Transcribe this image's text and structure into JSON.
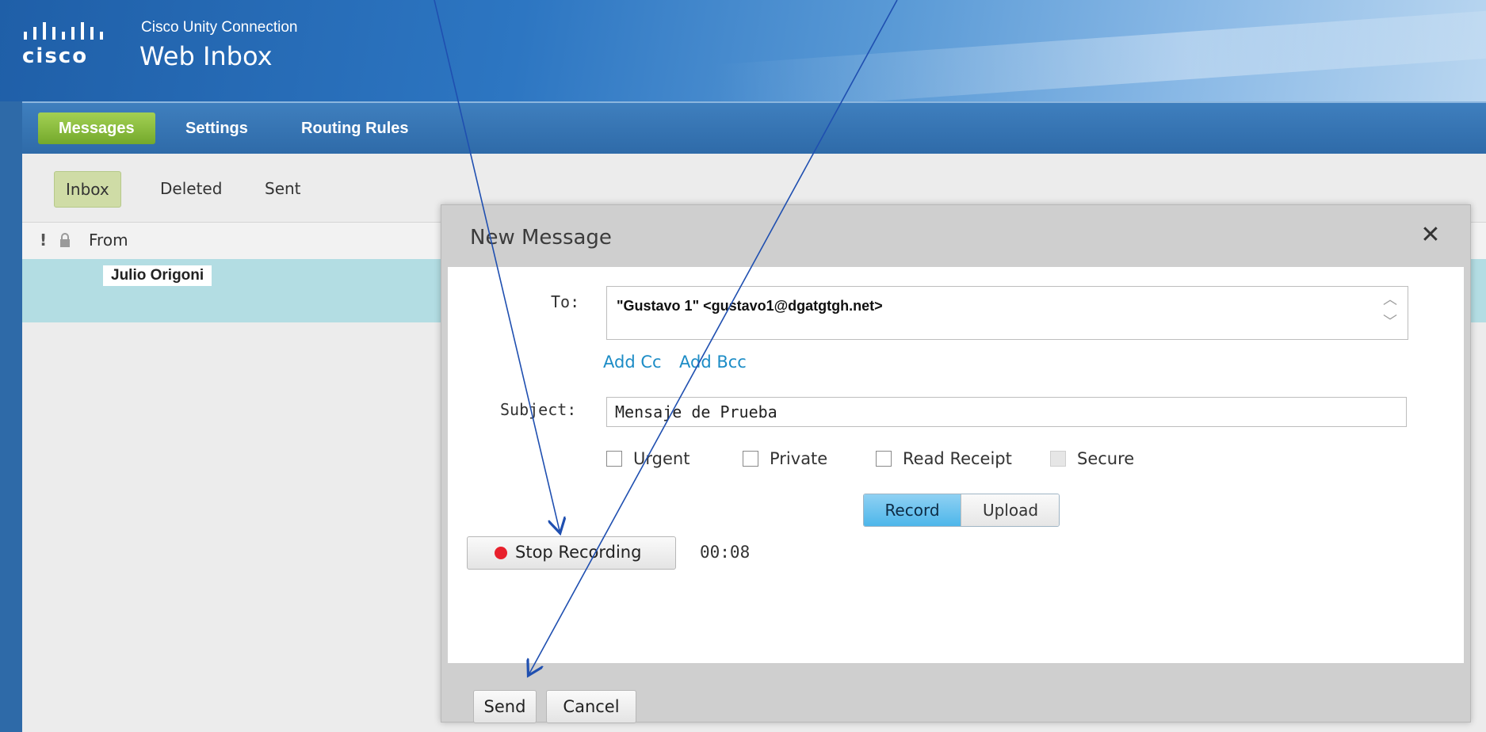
{
  "header": {
    "brand": "cisco",
    "product_name": "Cisco Unity Connection",
    "product_title": "Web Inbox"
  },
  "nav": {
    "tabs": [
      {
        "label": "Messages",
        "active": true
      },
      {
        "label": "Settings",
        "active": false
      },
      {
        "label": "Routing Rules",
        "active": false
      }
    ]
  },
  "folders": {
    "tabs": [
      {
        "label": "Inbox",
        "active": true
      },
      {
        "label": "Deleted",
        "active": false
      },
      {
        "label": "Sent",
        "active": false
      }
    ]
  },
  "list": {
    "columns": {
      "urgent_icon": "!",
      "lock_icon": "lock-icon",
      "from_label": "From"
    },
    "rows": [
      {
        "from": "Julio Origoni"
      }
    ]
  },
  "dialog": {
    "title": "New Message",
    "close_icon": "close-icon",
    "to_label": "To:",
    "to_value": "\"Gustavo 1\" <gustavo1@dgatgtgh.net>",
    "add_cc": "Add Cc",
    "add_bcc": "Add Bcc",
    "subject_label": "Subject:",
    "subject_value": "Mensaje de Prueba",
    "options": [
      {
        "label": "Urgent",
        "checked": false,
        "disabled": false
      },
      {
        "label": "Private",
        "checked": false,
        "disabled": false
      },
      {
        "label": "Read Receipt",
        "checked": false,
        "disabled": false
      },
      {
        "label": "Secure",
        "checked": false,
        "disabled": true
      }
    ],
    "mode_buttons": [
      {
        "label": "Record",
        "active": true
      },
      {
        "label": "Upload",
        "active": false
      }
    ],
    "stop_recording": "Stop Recording",
    "timer": "00:08",
    "send": "Send",
    "cancel": "Cancel"
  },
  "colors": {
    "header_blue": "#2d76c2",
    "active_tab_green": "#8fc441",
    "selected_row": "#b3dde3",
    "link_blue": "#1c8cc6",
    "record_active": "#4db6ea",
    "recording_dot": "#e8202c",
    "arrow": "#1f4fb0"
  }
}
